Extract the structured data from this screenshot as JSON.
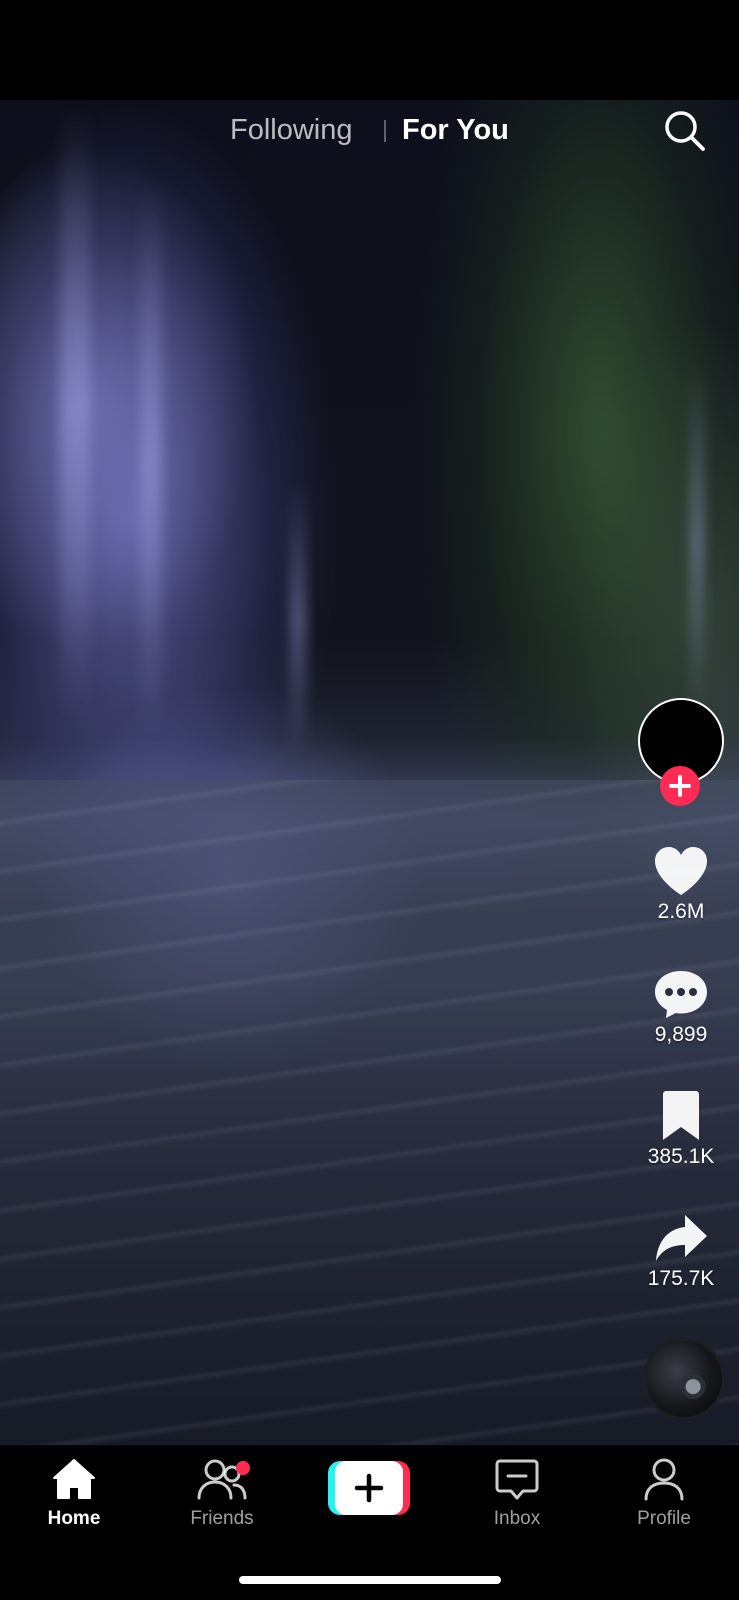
{
  "top_nav": {
    "tabs": [
      {
        "label": "Following",
        "active": false
      },
      {
        "label": "For You",
        "active": true
      }
    ],
    "search_icon": "search-icon"
  },
  "video": {
    "scene": "waterfall-fjord"
  },
  "actions": {
    "creator_avatar_icon": "avatar",
    "follow_icon": "plus-icon",
    "like": {
      "icon": "heart-icon",
      "count": "2.6M"
    },
    "comment": {
      "icon": "comment-bubble-icon",
      "count": "9,899"
    },
    "save": {
      "icon": "bookmark-icon",
      "count": "385.1K"
    },
    "share": {
      "icon": "share-arrow-icon",
      "count": "175.7K"
    },
    "music_disc_icon": "music-disc"
  },
  "bottom_nav": {
    "items": [
      {
        "label": "Home",
        "icon": "home-icon",
        "active": true
      },
      {
        "label": "Friends",
        "icon": "friends-icon",
        "active": false,
        "notification_dot": true
      },
      {
        "label": "",
        "icon": "create-plus-icon",
        "active": false
      },
      {
        "label": "Inbox",
        "icon": "inbox-icon",
        "active": false
      },
      {
        "label": "Profile",
        "icon": "profile-icon",
        "active": false
      }
    ]
  },
  "colors": {
    "accent_pink": "#fe2c55",
    "accent_cyan": "#25f4ee",
    "background": "#000000",
    "text": "#ffffff"
  }
}
